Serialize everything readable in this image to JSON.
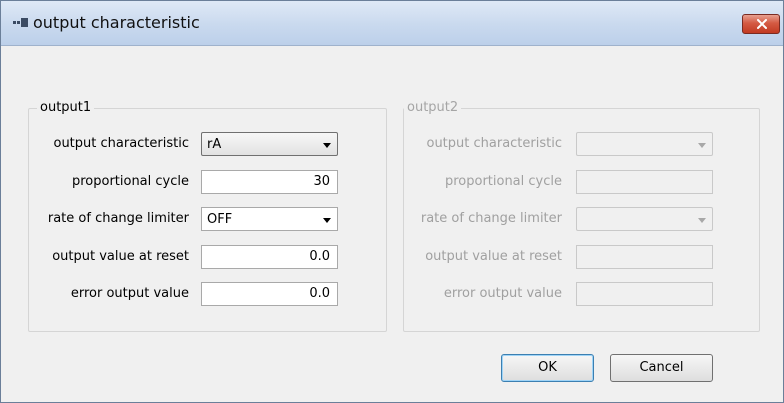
{
  "window": {
    "title": "output characteristic",
    "close_icon": "close-icon",
    "app_icon": "app-icon"
  },
  "output1": {
    "label": "output1",
    "rows": {
      "characteristic": {
        "label": "output characteristic",
        "value": "rA"
      },
      "cycle": {
        "label": "proportional cycle",
        "value": "30"
      },
      "limiter": {
        "label": "rate of change limiter",
        "value": "OFF"
      },
      "reset": {
        "label": "output value at reset",
        "value": "0.0"
      },
      "error": {
        "label": "error output value",
        "value": "0.0"
      }
    }
  },
  "output2": {
    "label": "output2",
    "rows": {
      "characteristic": {
        "label": "output characteristic",
        "value": ""
      },
      "cycle": {
        "label": "proportional cycle",
        "value": ""
      },
      "limiter": {
        "label": "rate of change limiter",
        "value": ""
      },
      "reset": {
        "label": "output value at reset",
        "value": ""
      },
      "error": {
        "label": "error output value",
        "value": ""
      }
    }
  },
  "buttons": {
    "ok": "OK",
    "cancel": "Cancel"
  },
  "colors": {
    "titlebar": "#c9d9ee",
    "close_button": "#c23a22",
    "dialog_bg": "#f0f0f0"
  }
}
